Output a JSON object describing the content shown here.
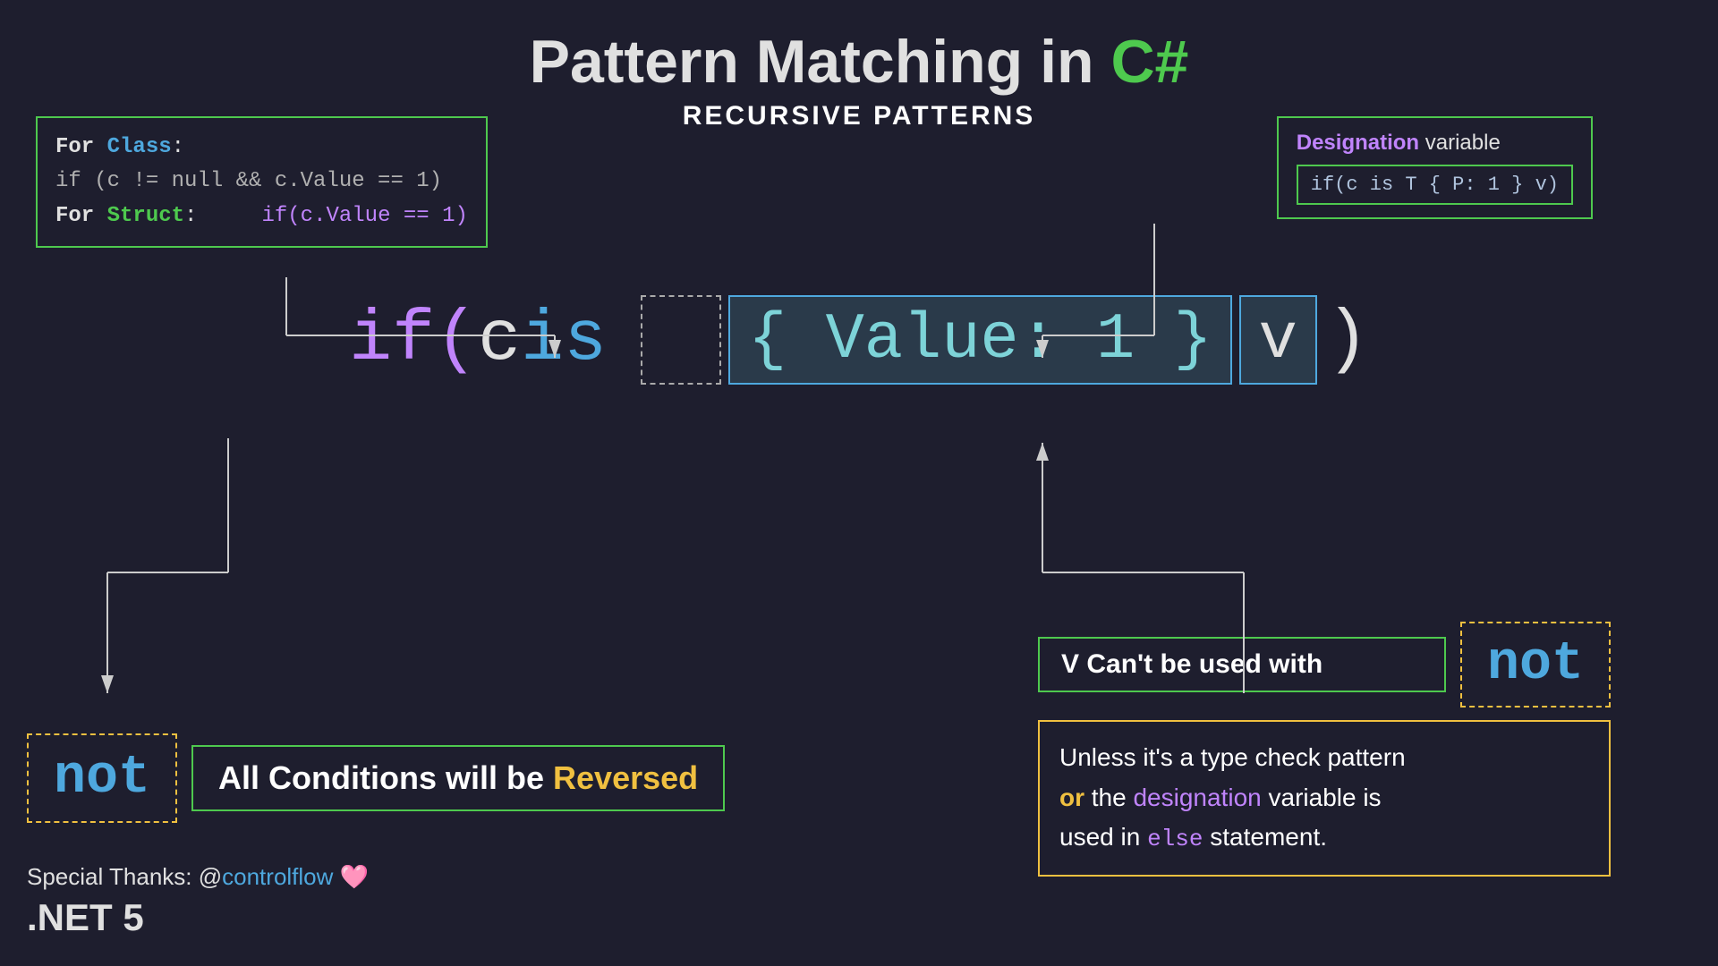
{
  "title": {
    "main": "Pattern Matching in ",
    "csharp": "C#",
    "subtitle": "RECURSIVE PATTERNS"
  },
  "top_left_box": {
    "line1_label": "For ",
    "line1_class": "Class",
    "line1_colon": ":",
    "line2_code": "if (c != null && c.Value == 1)",
    "line3_label": "For ",
    "line3_struct": "Struct",
    "line3_colon": ":",
    "line3_code": "if(c.Value == 1)"
  },
  "top_right_box": {
    "label_designation": "Designation",
    "label_rest": " variable",
    "inner_code": "if(c is T { P: 1 } v)"
  },
  "main_code": {
    "if": "if(",
    "c": "c",
    "is": " is",
    "property": "{ Value: 1 }",
    "v": "v",
    "close": " )"
  },
  "bottom_left": {
    "not_label": "not",
    "conditions_text": "All Conditions will be ",
    "reversed": "Reversed"
  },
  "bottom_right": {
    "vcant_text": "V Can't be used with",
    "not_label": "not",
    "unless_line1": "Unless it's a type check pattern",
    "unless_or": "or",
    "unless_line2": " the ",
    "unless_designation": "designation",
    "unless_line3": " variable is",
    "unless_line4": "used in ",
    "unless_else": "else",
    "unless_end": " statement."
  },
  "footer": {
    "thanks": "Special Thanks: @",
    "controlflow": "controlflow",
    "heart": "🩷",
    "dotnet": ".NET 5"
  }
}
